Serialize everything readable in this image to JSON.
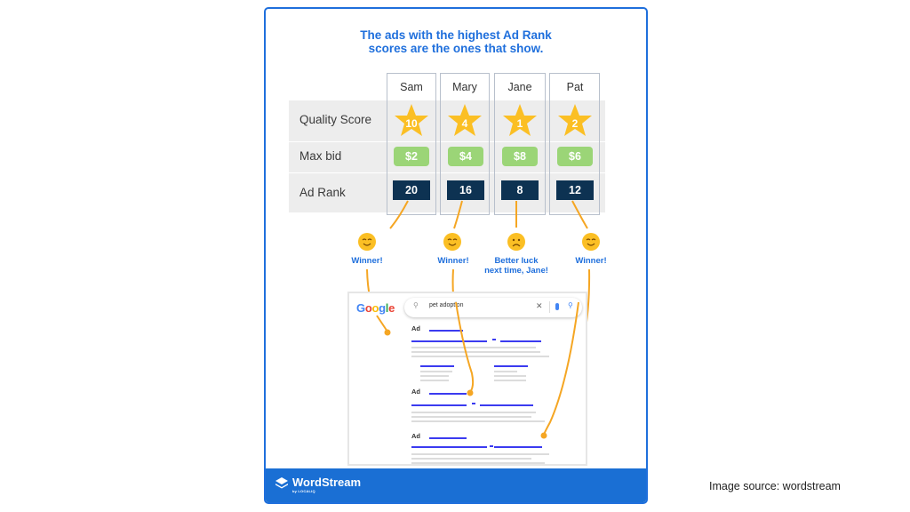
{
  "title": [
    "The ads with the highest Ad Rank",
    "scores are the ones that show."
  ],
  "row_labels": [
    "Quality Score",
    "Max bid",
    "Ad Rank"
  ],
  "advertisers": [
    {
      "name": "Sam",
      "quality_score": "10",
      "max_bid": "$2",
      "ad_rank": "20",
      "outcome": "winner",
      "label": [
        "Winner!"
      ]
    },
    {
      "name": "Mary",
      "quality_score": "4",
      "max_bid": "$4",
      "ad_rank": "16",
      "outcome": "winner",
      "label": [
        "Winner!"
      ]
    },
    {
      "name": "Jane",
      "quality_score": "1",
      "max_bid": "$8",
      "ad_rank": "8",
      "outcome": "loser",
      "label": [
        "Better luck",
        "next time, Jane!"
      ]
    },
    {
      "name": "Pat",
      "quality_score": "2",
      "max_bid": "$6",
      "ad_rank": "12",
      "outcome": "winner",
      "label": [
        "Winner!"
      ]
    }
  ],
  "serp": {
    "logo": "Google",
    "query": "pet adoption",
    "ad_label": "Ad",
    "icons": [
      "search-icon",
      "clear-icon",
      "microphone-icon",
      "search-icon"
    ]
  },
  "footer": {
    "brand": "WordStream",
    "byline": "by LOCALIQ"
  },
  "source_caption": "Image source: wordstream",
  "colors": {
    "brand_blue": "#1f6fdc",
    "star": "#fbbf24",
    "bid_green": "#9bd577",
    "rank_navy": "#0d3252",
    "connector": "#f5a623"
  }
}
